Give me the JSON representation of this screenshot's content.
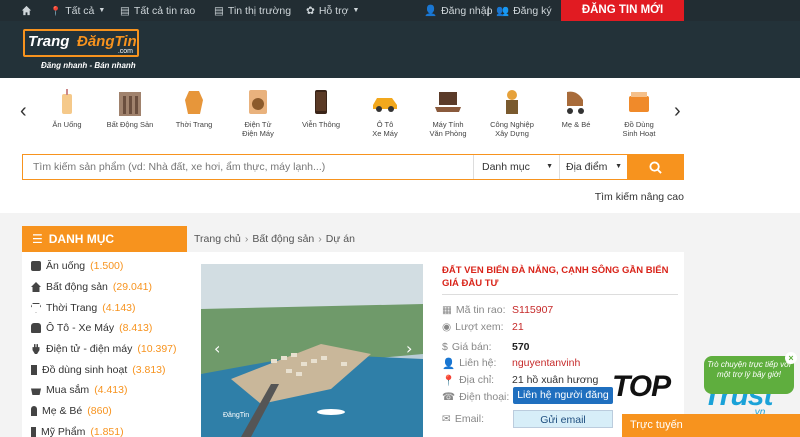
{
  "topnav": {
    "all": "Tất cả",
    "all_news": "Tất cả tin rao",
    "market": "Tin thị trường",
    "support": "Hỗ trợ",
    "login": "Đăng nhập",
    "register": "Đăng ký",
    "post_cta": "ĐĂNG TIN MỚI"
  },
  "logo": {
    "part1": "Trang",
    "part2": "ĐăngTin",
    "suffix": ".com",
    "tagline": "Đăng nhanh - Bán nhanh"
  },
  "categories": [
    {
      "label": "Ăn Uống",
      "icon": "drink-icon"
    },
    {
      "label": "Bất Động Sản",
      "icon": "building-icon"
    },
    {
      "label": "Thời Trang",
      "icon": "fashion-icon"
    },
    {
      "label": "Điện Tử\nĐiện Máy",
      "icon": "washer-icon"
    },
    {
      "label": "Viễn Thông",
      "icon": "phone-icon"
    },
    {
      "label": "Ô Tô\nXe Máy",
      "icon": "car-icon"
    },
    {
      "label": "Máy Tính\nVăn Phòng",
      "icon": "laptop-icon"
    },
    {
      "label": "Công Nghiệp\nXây Dựng",
      "icon": "construction-icon"
    },
    {
      "label": "Mẹ & Bé",
      "icon": "stroller-icon"
    },
    {
      "label": "Đồ Dùng\nSinh Hoạt",
      "icon": "box-icon"
    }
  ],
  "search": {
    "placeholder": "Tìm kiếm sản phẩm (vd: Nhà đất, xe hơi, ẩm thực, máy lạnh...)",
    "category": "Danh mục",
    "location": "Địa điểm",
    "advanced": "Tìm kiếm nâng cao"
  },
  "sidebar": {
    "title": "DANH MỤC",
    "items": [
      {
        "label": "Ăn uống",
        "count": "(1.500)"
      },
      {
        "label": "Bất động sản",
        "count": "(29.041)"
      },
      {
        "label": "Thời Trang",
        "count": "(4.143)"
      },
      {
        "label": "Ô Tô - Xe Máy",
        "count": "(8.413)"
      },
      {
        "label": "Điện tử - điện máy",
        "count": "(10.397)"
      },
      {
        "label": "Đồ dùng sinh hoạt",
        "count": "(3.813)"
      },
      {
        "label": "Mua sắm",
        "count": "(4.413)"
      },
      {
        "label": "Mẹ & Bé",
        "count": "(860)"
      },
      {
        "label": "Mỹ Phẩm",
        "count": "(1.851)"
      }
    ]
  },
  "breadcrumb": [
    "Trang chủ",
    "Bất động sản",
    "Dự án"
  ],
  "listing": {
    "title": "ĐẤT VEN BIỂN ĐÀ NẴNG, CẠNH SÔNG GẦN BIỂN GIÁ ĐẦU TƯ",
    "watermark": "ĐăngTin",
    "code_label": "Mã tin rao:",
    "code": "S115907",
    "views_label": "Lượt xem:",
    "views": "21",
    "price_label": "Giá bán:",
    "price": "570",
    "contact_label": "Liên hệ:",
    "contact": "nguyentanvinh",
    "address_label": "Địa chỉ:",
    "address": "21 hồ xuân hương",
    "phone_label": "Điện thoại:",
    "phone_button": "Liên hệ người đăng",
    "email_label": "Email:",
    "email_button": "Gửi email"
  },
  "chat": {
    "bubble": "Trò chuyện trực tiếp với một trợ lý bây giờ!",
    "bar": "Trực tuyến"
  },
  "watermark": {
    "top": "TOP",
    "trust": "Trust",
    "vn": ".vn"
  },
  "colors": {
    "orange": "#f7931e",
    "red_cta": "#e11b22",
    "nav_bg": "#222d33",
    "chat_green": "#5fae3e"
  }
}
